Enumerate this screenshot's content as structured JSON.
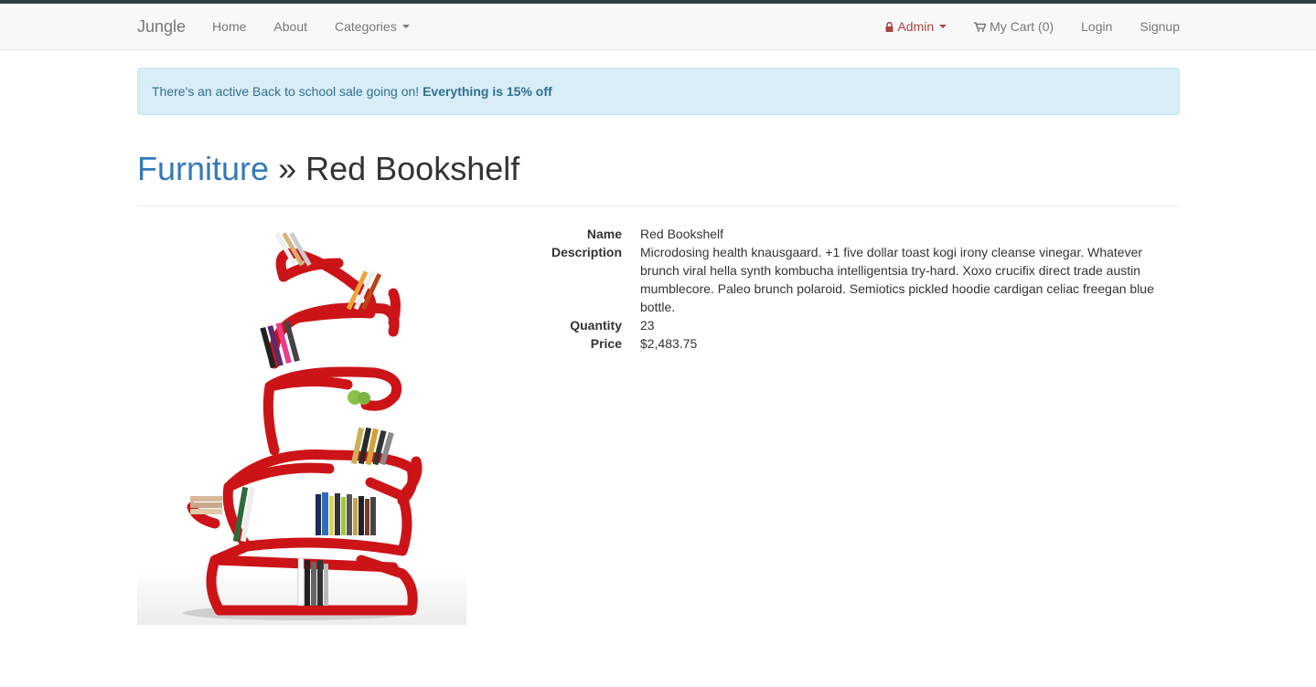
{
  "navbar": {
    "brand": "Jungle",
    "left_links": [
      "Home",
      "About",
      "Categories"
    ],
    "admin_label": "Admin",
    "cart_label": "My Cart (0)",
    "login_label": "Login",
    "signup_label": "Signup"
  },
  "alert": {
    "text": "There's an active Back to school sale going on! ",
    "strong": "Everything is 15% off"
  },
  "header": {
    "category": "Furniture",
    "separator": " » ",
    "product": "Red Bookshelf"
  },
  "product": {
    "fields": [
      {
        "label": "Name",
        "value": "Red Bookshelf"
      },
      {
        "label": "Description",
        "value": "Microdosing health knausgaard. +1 five dollar toast kogi irony cleanse vinegar. Whatever brunch viral hella synth kombucha intelligentsia try-hard. Xoxo crucifix direct trade austin mumblecore. Paleo brunch polaroid. Semiotics pickled hoodie cardigan celiac freegan blue bottle."
      },
      {
        "label": "Quantity",
        "value": "23"
      },
      {
        "label": "Price",
        "value": "$2,483.75"
      }
    ]
  },
  "icons": {
    "admin": "lock-icon",
    "cart": "shopping-cart-icon"
  },
  "colors": {
    "link": "#337ab7",
    "admin": "#a94442",
    "alert_bg": "#d9edf7",
    "shelf": "#cc1418"
  }
}
